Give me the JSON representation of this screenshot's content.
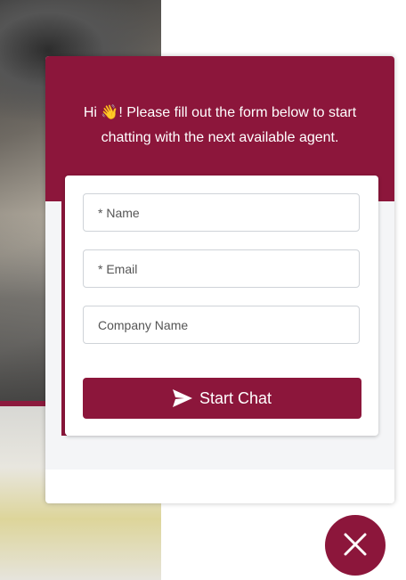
{
  "chat_widget": {
    "greeting_prefix": "Hi ",
    "greeting_emoji": "👋",
    "greeting_text": "! Please fill out the form below to start chatting with the next available agent.",
    "form": {
      "name_placeholder": "* Name",
      "email_placeholder": "* Email",
      "company_placeholder": "Company Name",
      "submit_label": "Start Chat",
      "submit_icon": "send-icon"
    },
    "close_icon": "close-icon"
  },
  "colors": {
    "brand": "#8c163b",
    "form_background": "#f4f5f7"
  }
}
